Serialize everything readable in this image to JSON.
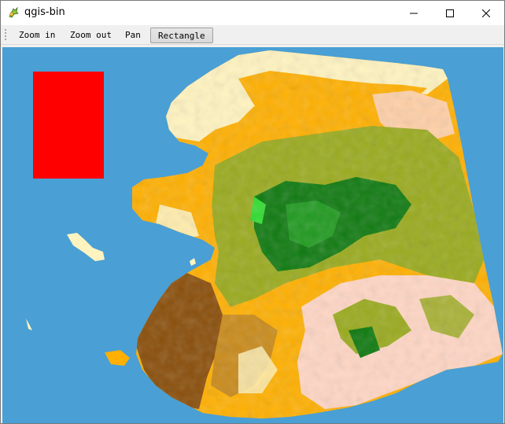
{
  "window": {
    "title": "qgis-bin",
    "app_icon": "qgis-logo-icon",
    "controls": [
      "minimize-icon",
      "maximize-icon",
      "close-icon"
    ]
  },
  "toolbar": {
    "zoom_in": "Zoom in",
    "zoom_out": "Zoom out",
    "pan": "Pan",
    "rectangle": "Rectangle",
    "active_tool": "Rectangle"
  },
  "map": {
    "background_color": "#4a9fd5",
    "selection_rect_color": "#ff0000",
    "land_colors": {
      "tundra_light": "#fff4c0",
      "shrub_orange": "#ffb000",
      "forest_olive": "#9aab1e",
      "forest_dark": "#0f7a10",
      "forest_bright": "#33dd33",
      "wetland_brown": "#8a4e0a",
      "ice_pink": "#ffd6c4"
    }
  }
}
